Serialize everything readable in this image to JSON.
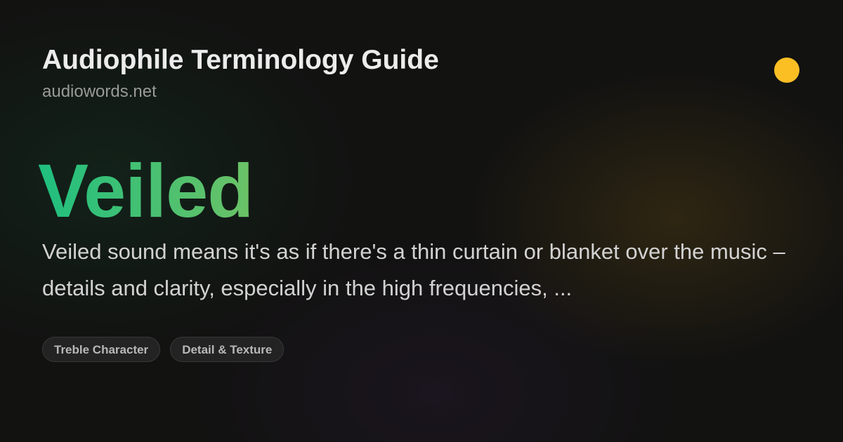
{
  "header": {
    "site_title": "Audiophile Terminology Guide",
    "site_domain": "audiowords.net"
  },
  "indicator": {
    "color": "#fbbf24"
  },
  "entry": {
    "term": "Veiled",
    "term_gradient": [
      "#1fbf7f",
      "#6cc266"
    ],
    "definition": "Veiled sound means it's as if there's a thin curtain or blanket over the music – details and clarity, especially in the high frequencies, ..."
  },
  "tags": [
    {
      "label": "Treble Character"
    },
    {
      "label": "Detail & Texture"
    }
  ]
}
